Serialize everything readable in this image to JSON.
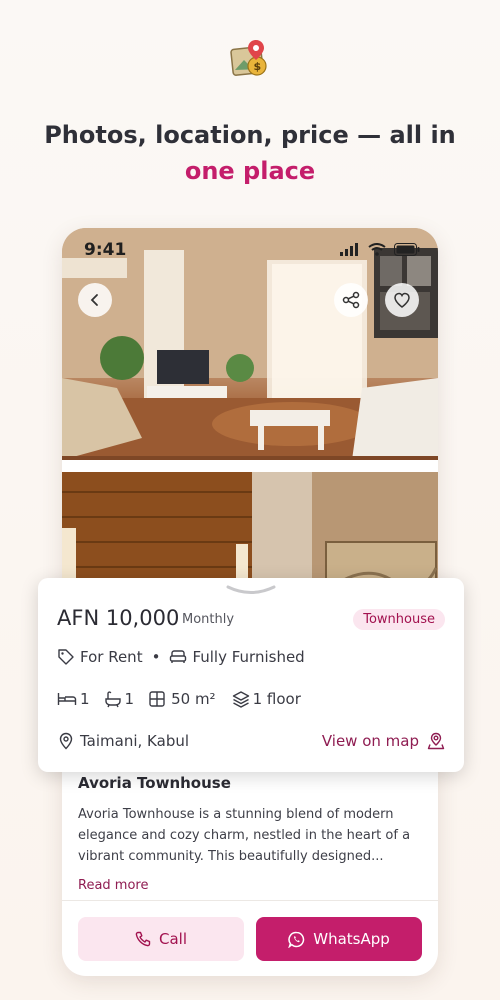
{
  "headline": {
    "line1": "Photos, location, price — all in",
    "line2": "one place",
    "accent_color": "#c41e6b"
  },
  "status_bar": {
    "time": "9:41"
  },
  "icons": {
    "app": "map-pin-price-icon",
    "back": "chevron-left-icon",
    "share": "share-icon",
    "favorite": "heart-icon",
    "tag": "tag-icon",
    "sofa": "sofa-icon",
    "bed": "bed-icon",
    "bath": "bath-icon",
    "area": "area-icon",
    "layers": "layers-icon",
    "location": "location-pin-icon",
    "map_person": "map-person-icon",
    "phone": "phone-icon",
    "whatsapp": "whatsapp-icon"
  },
  "listing": {
    "price": "AFN 10,000",
    "period": "Monthly",
    "type": "Townhouse",
    "offer": "For Rent",
    "separator": "•",
    "furnishing": "Fully Furnished",
    "beds": "1",
    "baths": "1",
    "area": "50 m²",
    "floors": "1 floor",
    "location": "Taimani, Kabul",
    "view_map": "View on map"
  },
  "description": {
    "title": "Avoria Townhouse",
    "text": "Avoria Townhouse is a stunning blend of modern elegance and cozy charm, nestled in the heart of a vibrant community. This beautifully designed...",
    "read_more": "Read more"
  },
  "actions": {
    "call": "Call",
    "whatsapp": "WhatsApp"
  }
}
